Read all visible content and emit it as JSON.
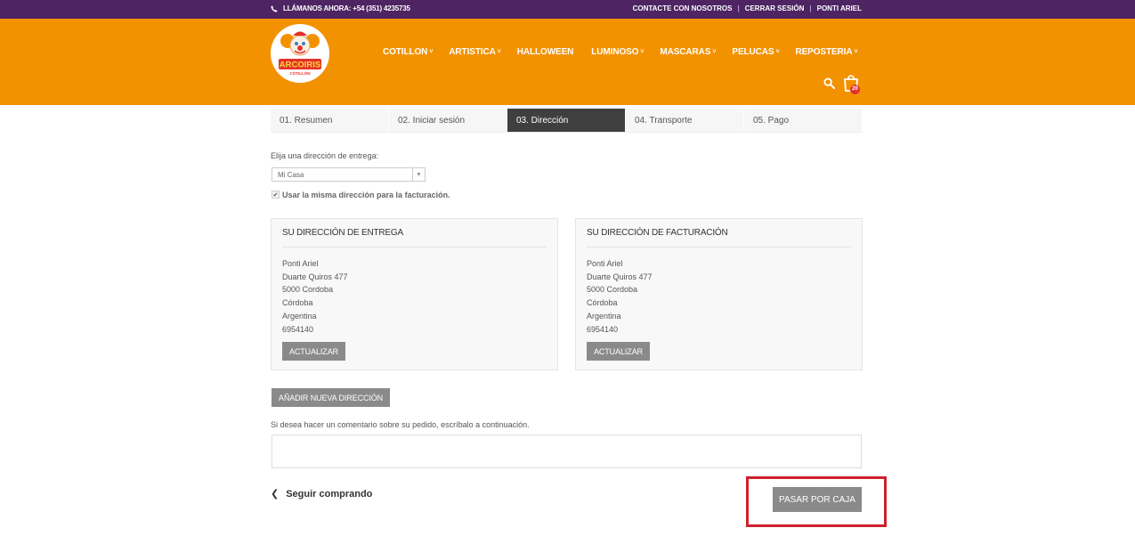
{
  "topbar": {
    "phone_text": "LLÁMANOS AHORA: +54 (351) 4235735",
    "links": [
      "CONTACTE CON NOSOTROS",
      "CERRAR SESIÓN",
      "PONTI ARIEL"
    ]
  },
  "header": {
    "logo_text": "ARCOIRIS",
    "logo_subtext": "COTILLÓN",
    "nav": [
      {
        "label": "COTILLON",
        "caret": "˅"
      },
      {
        "label": "ARTISTICA",
        "caret": "˅"
      },
      {
        "label": "HALLOWEEN",
        "caret": ""
      },
      {
        "label": "LUMINOSO",
        "caret": "˅"
      },
      {
        "label": "MASCARAS",
        "caret": "˅"
      },
      {
        "label": "PELUCAS",
        "caret": "˅"
      },
      {
        "label": "REPOSTERIA",
        "caret": "˅"
      }
    ],
    "cart_count": "20",
    "accent": "#f39200",
    "topbar_color": "#4e2462"
  },
  "steps": [
    {
      "label": "01. Resumen"
    },
    {
      "label": "02. Iniciar sesión"
    },
    {
      "label": "03. Dirección"
    },
    {
      "label": "04. Transporte"
    },
    {
      "label": "05. Pago"
    }
  ],
  "address": {
    "choose_label": "Elija una dirección de entrega:",
    "selected": "Mi Casa",
    "same_billing_label": "Usar la misma dirección para la facturación.",
    "delivery": {
      "title": "SU DIRECCIÓN DE ENTREGA",
      "lines": [
        "Ponti Ariel",
        "Duarte Quiros 477",
        "5000 Cordoba",
        "Córdoba",
        "Argentina",
        "6954140"
      ],
      "button": "ACTUALIZAR"
    },
    "billing": {
      "title": "SU DIRECCIÓN DE FACTURACIÓN",
      "lines": [
        "Ponti Ariel",
        "Duarte Quiros 477",
        "5000 Cordoba",
        "Córdoba",
        "Argentina",
        "6954140"
      ],
      "button": "ACTUALIZAR"
    },
    "add_button": "AÑADIR NUEVA DIRECCIÓN",
    "comment_label": "Si desea hacer un comentario sobre su pedido, escríbalo a continuación.",
    "comment_value": ""
  },
  "footer": {
    "continue_label": "Seguir comprando",
    "checkout_label": "PASAR POR CAJA"
  }
}
